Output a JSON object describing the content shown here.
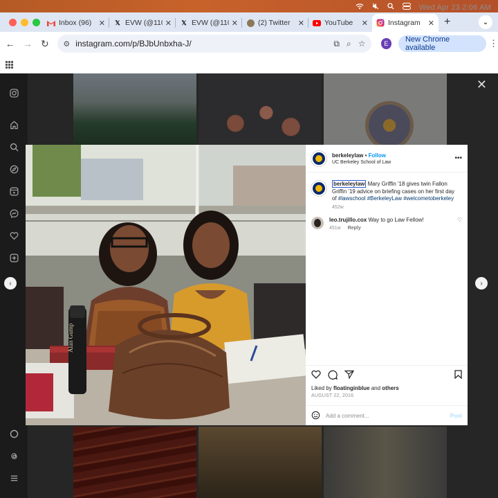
{
  "menubar": {
    "datetime": "Wed Apr 23  2:06 AM"
  },
  "tabs": [
    {
      "label": "Inbox (96)",
      "favicon": "gmail-icon"
    },
    {
      "label": "EVW (@110",
      "favicon": "x-icon"
    },
    {
      "label": "EVW (@110",
      "favicon": "x-icon"
    },
    {
      "label": "(2) Twitter",
      "favicon": "twitter-icon"
    },
    {
      "label": "YouTube",
      "favicon": "youtube-icon"
    },
    {
      "label": "Instagram",
      "favicon": "instagram-icon",
      "active": true
    }
  ],
  "address": {
    "url": "instagram.com/p/BJbUnbxha-J/"
  },
  "profile_initial": "E",
  "chrome_update_label": "New Chrome available",
  "post": {
    "username": "berkeleylaw",
    "separator": "•",
    "follow_label": "Follow",
    "subtitle": "UC Berkeley School of Law",
    "caption": {
      "tagged_user": "berkeleylaw",
      "text": " Mary Griffin '18 gives twin Fallon Griffin '19 advice on briefing cases on her first day of ",
      "hashtags": [
        "#lawschool",
        "#BerkeleyLaw",
        "#welcometoberkeley"
      ],
      "age": "452w"
    },
    "comment": {
      "username": "leo.trujillo.cox",
      "text": " Way to go Law Fellow!",
      "age": "451w",
      "reply_label": "Reply"
    },
    "likes": {
      "prefix": "Liked by ",
      "user": "floatinginblue",
      "middle": " and ",
      "others": "others"
    },
    "date": "AUGUST 22, 2016",
    "add_comment_placeholder": "Add a comment...",
    "post_label": "Post",
    "bottle_text": "Alan Gump"
  },
  "colors": {
    "instagram_link": "#0095f6",
    "hashtag": "#00376b",
    "overlay": "#262626"
  }
}
